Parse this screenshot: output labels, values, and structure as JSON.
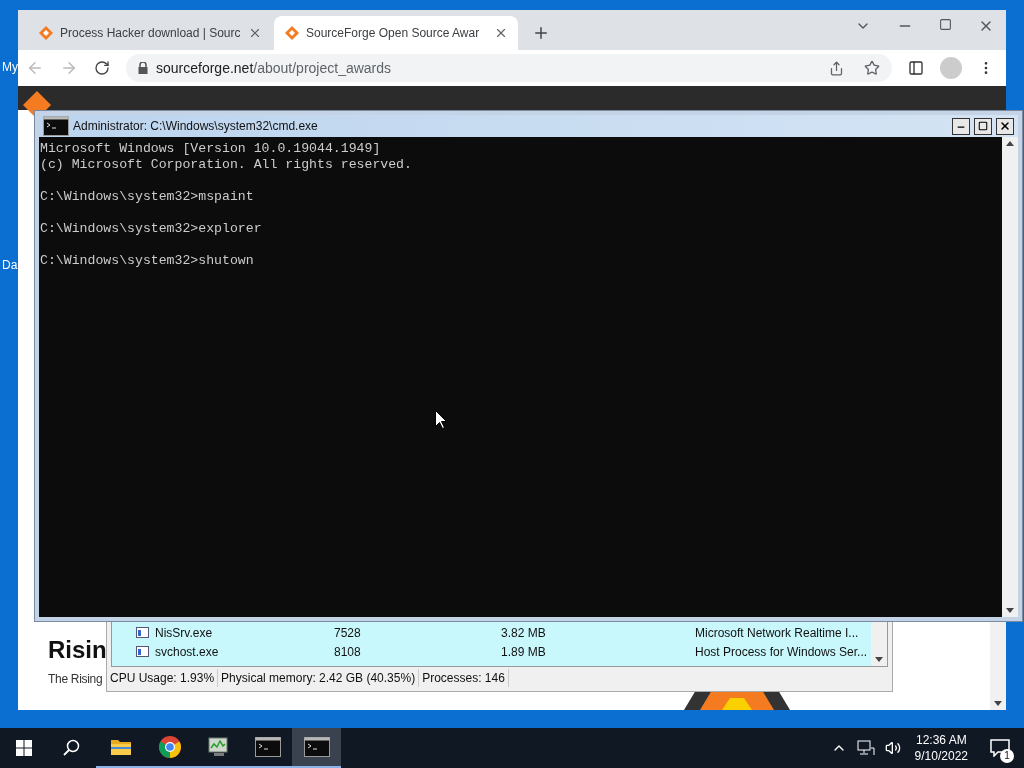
{
  "desktop": {
    "icon_labels": [
      "My",
      "Da"
    ]
  },
  "browser": {
    "tabs": [
      {
        "title": "Process Hacker download | Sourc",
        "selected": false
      },
      {
        "title": "SourceForge Open Source Awar",
        "selected": true
      }
    ],
    "address": {
      "host": "sourceforge.net",
      "path": "/about/project_awards"
    },
    "page": {
      "heading": "Risin",
      "paragraph": "The Rising"
    }
  },
  "cmd": {
    "title": "Administrator: C:\\Windows\\system32\\cmd.exe",
    "blocks": [
      [
        "Microsoft Windows [Version 10.0.19044.1949]",
        "(c) Microsoft Corporation. All rights reserved."
      ],
      [
        "C:\\Windows\\system32>mspaint"
      ],
      [
        "C:\\Windows\\system32>explorer"
      ],
      [
        "C:\\Windows\\system32>shutown"
      ]
    ]
  },
  "process_list": {
    "rows": [
      {
        "name": "NisSrv.exe",
        "pid": "7528",
        "memory": "3.82 MB",
        "description": "Microsoft Network Realtime I..."
      },
      {
        "name": "svchost.exe",
        "pid": "8108",
        "memory": "1.89 MB",
        "description": "Host Process for Windows Ser..."
      }
    ],
    "status": [
      "CPU Usage: 1.93%",
      "Physical memory: 2.42 GB (40.35%)",
      "Processes: 146"
    ]
  },
  "taskbar": {
    "apps": [
      {
        "kind": "folder",
        "running": true,
        "selected": false
      },
      {
        "kind": "chrome",
        "running": true,
        "selected": false
      },
      {
        "kind": "monitor",
        "running": true,
        "selected": false
      },
      {
        "kind": "console",
        "running": true,
        "selected": false
      },
      {
        "kind": "console",
        "running": true,
        "selected": true
      }
    ],
    "clock": {
      "time": "12:36 AM",
      "date": "9/10/2022"
    },
    "notifications": "1"
  }
}
